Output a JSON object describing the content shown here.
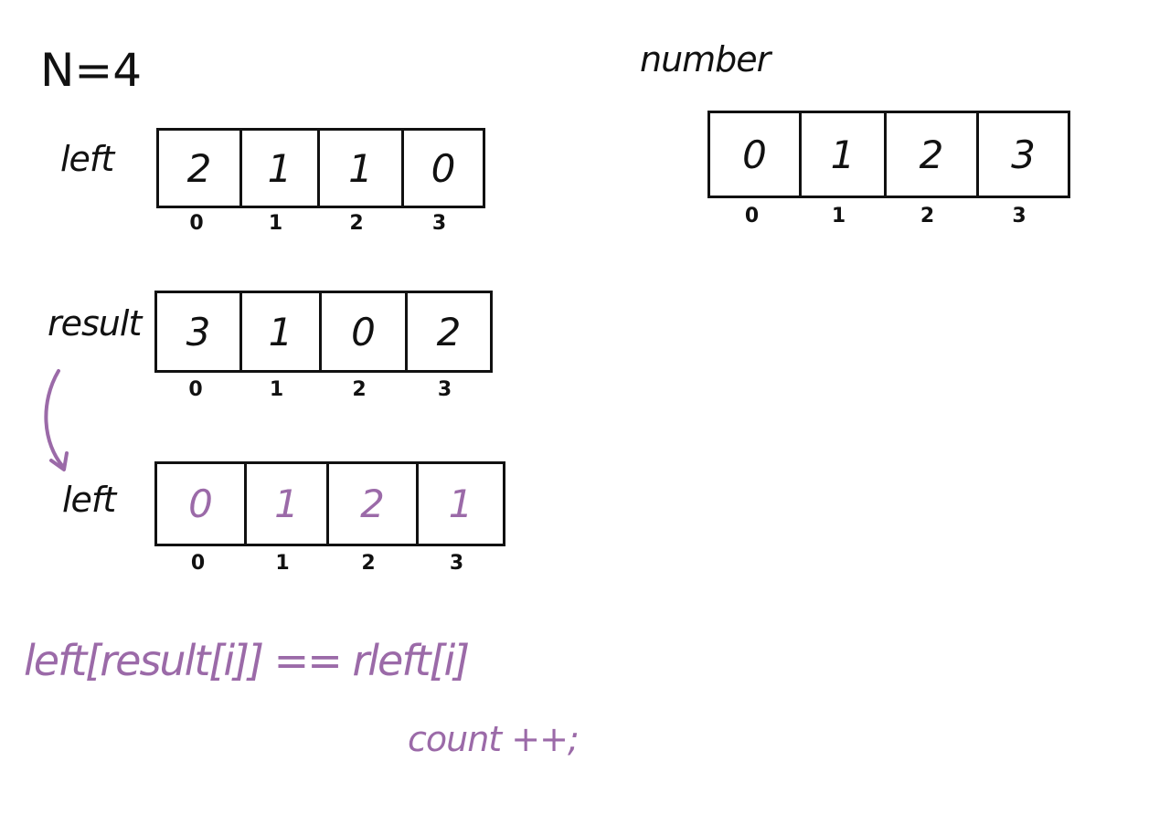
{
  "title": "N=4",
  "accent_color": "#9b6aa8",
  "arrays": {
    "left_top": {
      "label": "left",
      "cells": [
        "2",
        "1",
        "1",
        "0"
      ],
      "indices": [
        "0",
        "1",
        "2",
        "3"
      ]
    },
    "result": {
      "label": "result",
      "cells": [
        "3",
        "1",
        "0",
        "2"
      ],
      "indices": [
        "0",
        "1",
        "2",
        "3"
      ]
    },
    "left_bottom": {
      "label": "left",
      "cells": [
        "0",
        "1",
        "2",
        "1"
      ],
      "indices": [
        "0",
        "1",
        "2",
        "3"
      ]
    },
    "number": {
      "label": "number",
      "cells": [
        "0",
        "1",
        "2",
        "3"
      ],
      "indices": [
        "0",
        "1",
        "2",
        "3"
      ]
    }
  },
  "notes": {
    "formula": "left[result[i]] == rleft[i]",
    "count": "count ++;"
  }
}
